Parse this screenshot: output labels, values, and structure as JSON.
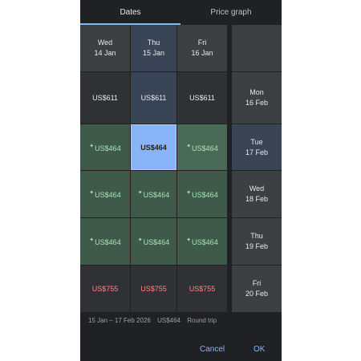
{
  "tabs": [
    {
      "label": "Dates",
      "active": true
    },
    {
      "label": "Price graph",
      "active": false
    }
  ],
  "depart_headers": [
    {
      "day": "Wed",
      "date": "14 Jan"
    },
    {
      "day": "Thu",
      "date": "15 Jan",
      "selected": true
    },
    {
      "day": "Fri",
      "date": "16 Jan"
    }
  ],
  "return_headers": [
    {
      "day": "Mon",
      "date": "16 Feb"
    },
    {
      "day": "Tue",
      "date": "17 Feb",
      "selected": true
    },
    {
      "day": "Wed",
      "date": "18 Feb"
    },
    {
      "day": "Thu",
      "date": "19 Feb"
    },
    {
      "day": "Fri",
      "date": "20 Feb"
    }
  ],
  "prices": [
    [
      "US$611",
      "US$611",
      "US$611"
    ],
    [
      "US$464",
      "US$464",
      "US$464"
    ],
    [
      "US$464",
      "US$464",
      "US$464"
    ],
    [
      "US$464",
      "US$464",
      "US$464"
    ],
    [
      "US$755",
      "US$755",
      "US$755"
    ]
  ],
  "summary": {
    "dates": "15 Jan – 17 Feb 2026",
    "price": "US$464",
    "trip": "Round trip"
  },
  "actions": {
    "cancel": "Cancel",
    "ok": "OK"
  },
  "colors": {
    "accent": "#8ab4f8",
    "low_price": "#a8e6b8",
    "high_price": "#f28b82",
    "background": "#202124"
  }
}
